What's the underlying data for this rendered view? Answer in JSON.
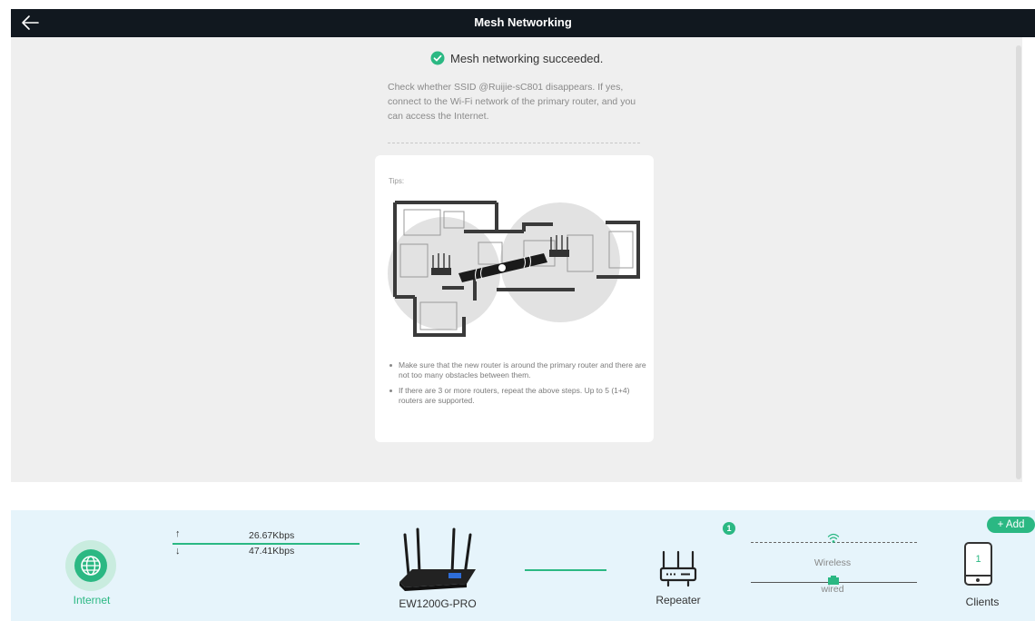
{
  "header": {
    "title": "Mesh Networking"
  },
  "main": {
    "success_message": "Mesh networking succeeded.",
    "description": "Check whether SSID @Ruijie-sC801 disappears. If yes, connect to the Wi-Fi network of the primary router, and you can access the Internet.",
    "tips": {
      "label": "Tips:",
      "items": [
        "Make sure that the new router is around the primary router and there are not too many obstacles between them.",
        "If there are 3 or more routers, repeat the above steps. Up to 5 (1+4) routers are supported."
      ]
    }
  },
  "topology": {
    "internet_label": "Internet",
    "upload_speed": "26.67Kbps",
    "download_speed": "47.41Kbps",
    "router_label": "EW1200G-PRO",
    "repeater_label": "Repeater",
    "repeater_count": "1",
    "wireless_label": "Wireless",
    "wired_label": "wired",
    "clients_label": "Clients",
    "clients_count": "1",
    "add_button": "+ Add"
  },
  "colors": {
    "accent": "#2bb883",
    "topbar": "#11181f",
    "panel": "#efefef",
    "bottom_bar": "#e6f4fb"
  },
  "icons": [
    "back-arrow-icon",
    "check-circle-icon",
    "globe-icon",
    "up-arrow-icon",
    "down-arrow-icon",
    "router-icon",
    "repeater-icon",
    "wifi-icon",
    "ethernet-icon",
    "phone-icon"
  ]
}
